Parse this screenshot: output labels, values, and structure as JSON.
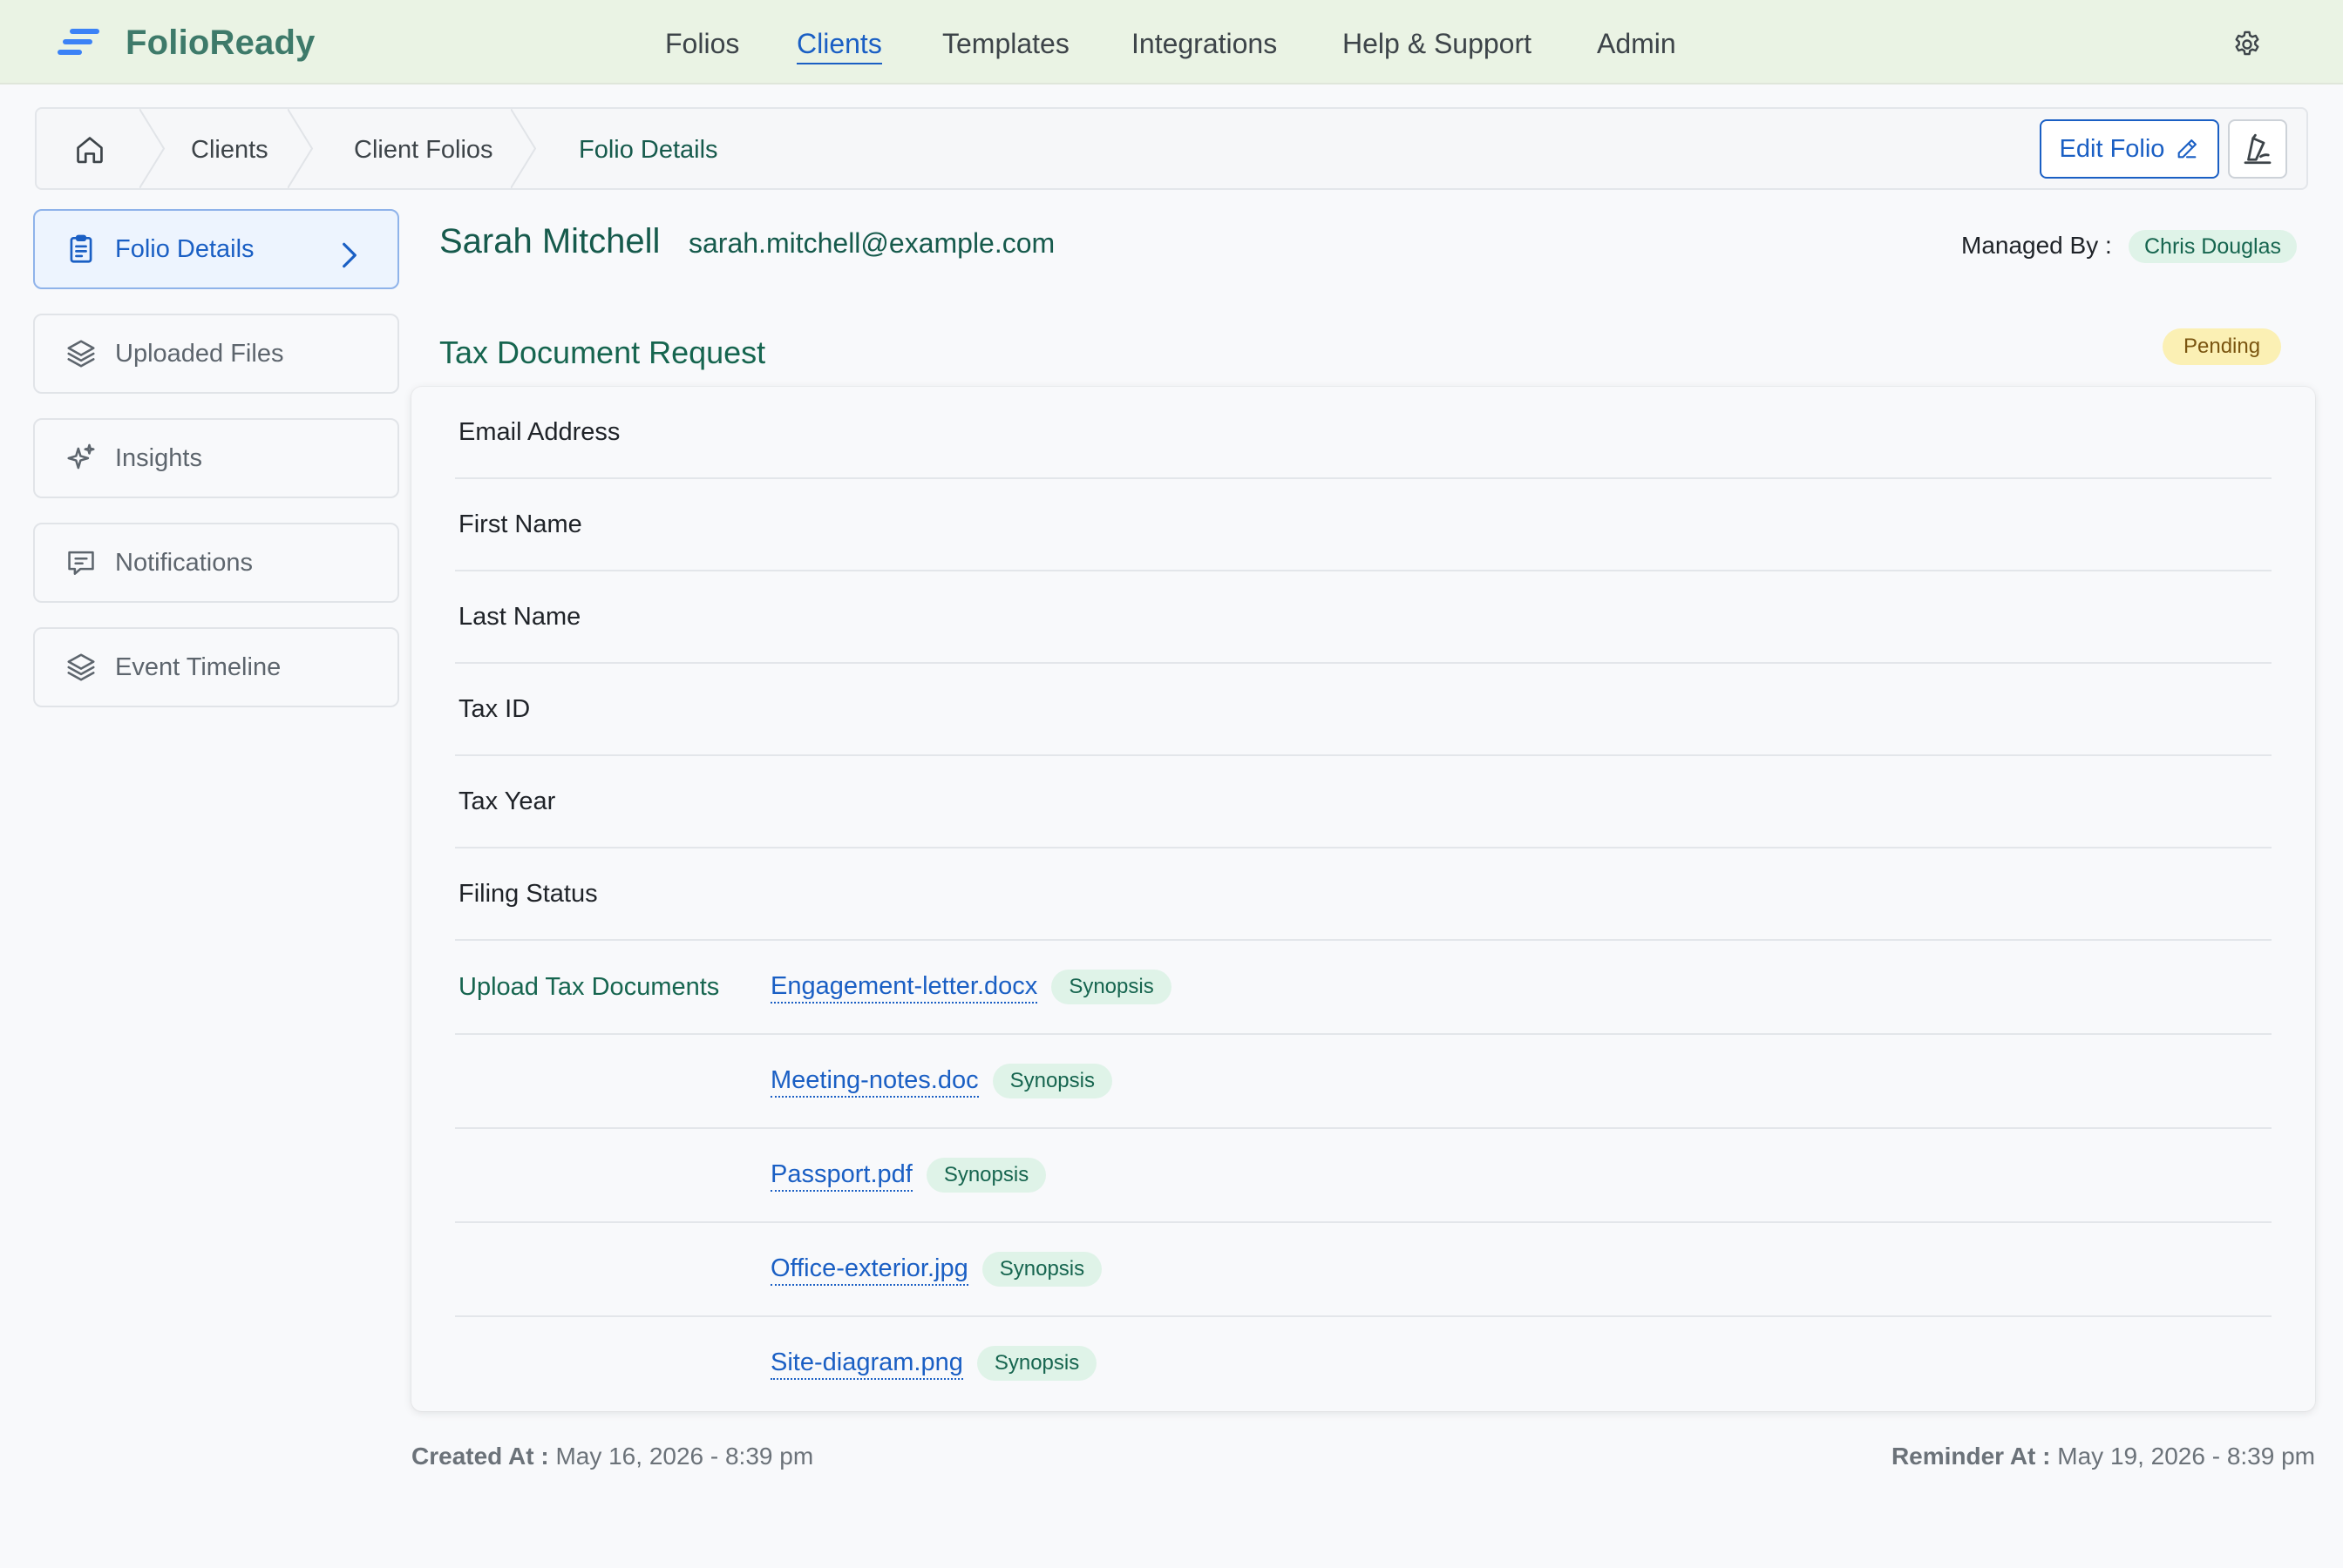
{
  "app": {
    "name": "FolioReady",
    "accent": "#1a5fc4",
    "brand_green": "#16654f",
    "topbar_bg": "#eaf3e4"
  },
  "nav": {
    "items": [
      "Folios",
      "Clients",
      "Templates",
      "Integrations",
      "Help & Support",
      "Admin"
    ],
    "active": "Clients"
  },
  "breadcrumb": {
    "home_icon": "home-icon",
    "items": [
      "Clients",
      "Client Folios",
      "Folio Details"
    ]
  },
  "toolbar": {
    "edit_label": "Edit Folio",
    "edit_icon": "pencil-icon",
    "sign_icon": "signature-icon"
  },
  "sidebar": {
    "items": [
      {
        "label": "Folio Details",
        "icon": "clipboard-icon",
        "active": true
      },
      {
        "label": "Uploaded Files",
        "icon": "layers-icon",
        "active": false
      },
      {
        "label": "Insights",
        "icon": "sparkles-icon",
        "active": false
      },
      {
        "label": "Notifications",
        "icon": "message-icon",
        "active": false
      },
      {
        "label": "Event Timeline",
        "icon": "layers-icon",
        "active": false
      }
    ]
  },
  "client": {
    "name": "Sarah Mitchell",
    "email": "sarah.mitchell@example.com",
    "managed_by_label": "Managed By :",
    "managed_by": "Chris Douglas"
  },
  "request": {
    "title": "Tax Document Request",
    "status": "Pending",
    "status_color": "#fbf0b4",
    "fields": [
      {
        "label": "Email Address"
      },
      {
        "label": "First Name"
      },
      {
        "label": "Last Name"
      },
      {
        "label": "Tax ID"
      },
      {
        "label": "Tax Year"
      },
      {
        "label": "Filing Status"
      }
    ],
    "upload_label": "Upload Tax Documents",
    "synopsis_label": "Synopsis",
    "files": [
      "Engagement-letter.docx",
      "Meeting-notes.doc",
      "Passport.pdf",
      "Office-exterior.jpg",
      "Site-diagram.png"
    ]
  },
  "footer": {
    "created_label": "Created At :",
    "created_value": "May 16, 2026 - 8:39 pm",
    "reminder_label": "Reminder At :",
    "reminder_value": "May 19, 2026 - 8:39 pm"
  }
}
